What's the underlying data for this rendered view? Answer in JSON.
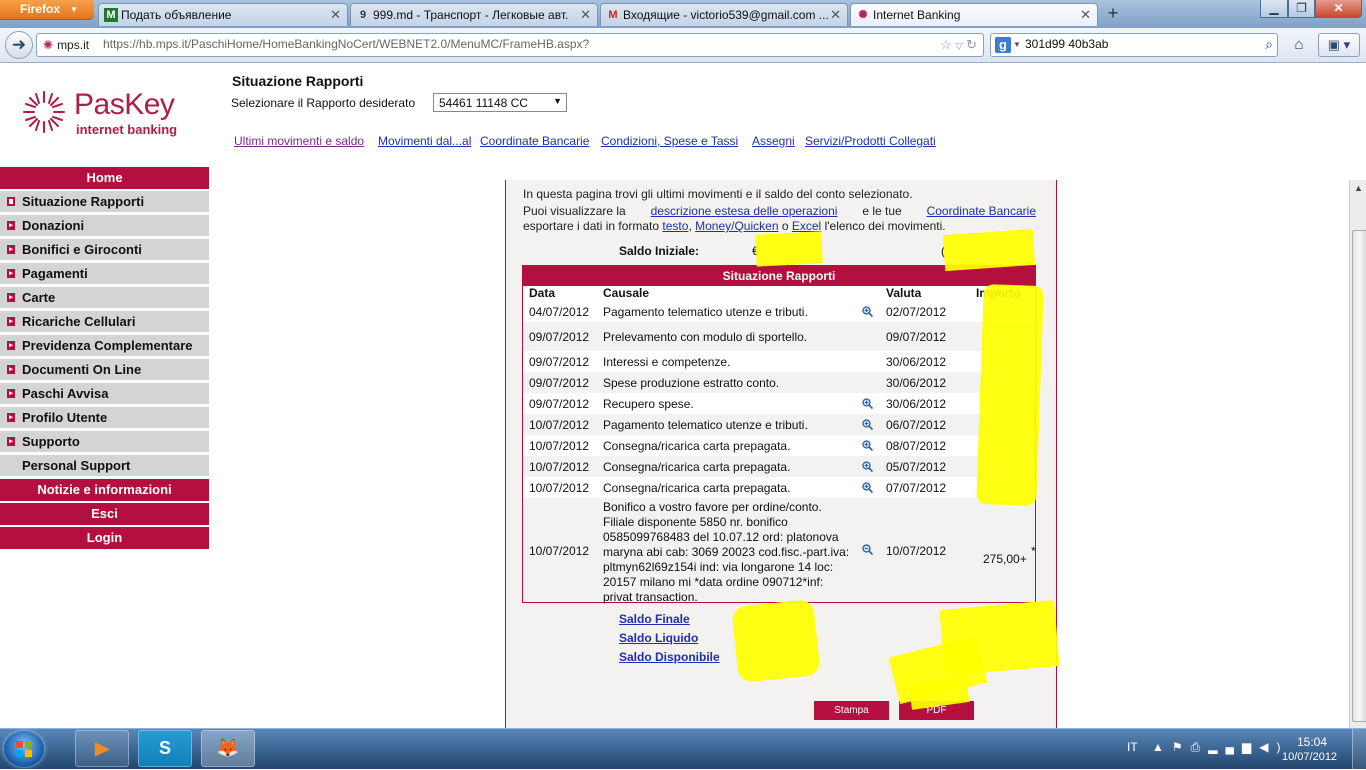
{
  "browser": {
    "menu_button": "Firefox",
    "tabs": [
      {
        "label": "Подать объявление",
        "icon": "M",
        "active": false
      },
      {
        "label": "999.md - Транспорт - Легковые авт...",
        "icon": "9",
        "active": false
      },
      {
        "label": "Входящие - victorio539@gmail.com ...",
        "icon": "M",
        "active": false
      },
      {
        "label": "Internet Banking",
        "icon": "✺",
        "active": true
      }
    ],
    "new_tab": "+",
    "site_identity": "mps.it",
    "url": "https://hb.mps.it/PaschiHome/HomeBankingNoCert/WEBNET2.0/MenuMC/FrameHB.aspx?",
    "search_text": "301d99  40b3ab"
  },
  "logo": {
    "name": "PasKey",
    "sub": "internet banking"
  },
  "header": {
    "title": "Situazione Rapporti",
    "select_label": "Selezionare il Rapporto desiderato",
    "select_value": "54461 11148 CC"
  },
  "top_links": [
    "Ultimi movimenti e saldo",
    "Movimenti dal...al",
    "Coordinate Bancarie",
    "Condizioni, Spese e Tassi",
    "Assegni",
    "Servizi/Prodotti Collegati"
  ],
  "sidebar": [
    {
      "label": "Home",
      "style": "red"
    },
    {
      "label": "Situazione Rapporti",
      "style": "selected"
    },
    {
      "label": "Donazioni",
      "style": "grey"
    },
    {
      "label": "Bonifici e Giroconti",
      "style": "grey"
    },
    {
      "label": "Pagamenti",
      "style": "grey"
    },
    {
      "label": "Carte",
      "style": "grey"
    },
    {
      "label": "Ricariche Cellulari",
      "style": "grey"
    },
    {
      "label": "Previdenza Complementare",
      "style": "grey"
    },
    {
      "label": "Documenti On Line",
      "style": "grey"
    },
    {
      "label": "Paschi Avvisa",
      "style": "grey"
    },
    {
      "label": "Profilo Utente",
      "style": "grey"
    },
    {
      "label": "Supporto",
      "style": "grey"
    },
    {
      "label": "Personal Support",
      "style": "plain"
    },
    {
      "label": "Notizie e informazioni",
      "style": "red"
    },
    {
      "label": "Esci",
      "style": "red"
    },
    {
      "label": "Login",
      "style": "red"
    }
  ],
  "intro": {
    "line1": "In questa pagina trovi gli ultimi movimenti e il saldo del conto selezionato.",
    "line2_a": "Puoi visualizzare la",
    "line2_link1": "descrizione estesa delle operazioni",
    "line2_b": "e le tue",
    "line2_link2": "Coordinate Bancarie",
    "line3_a": "esportare i dati in formato",
    "line3_link1": "testo",
    "line3_sep": ",",
    "line3_link2": "Money/Quicken",
    "line3_b": "o",
    "line3_link3": "Excel",
    "line3_c": "l'elenco dei movimenti."
  },
  "saldo_iniziale": {
    "label": "Saldo Iniziale:",
    "currency": "€",
    "paren": "("
  },
  "table": {
    "title": "Situazione Rapporti",
    "columns": [
      "Data",
      "Causale",
      "Valuta",
      "Importo"
    ],
    "rows": [
      {
        "data": "04/07/2012",
        "causale": "Pagamento telematico utenze e tributi.",
        "valuta": "02/07/2012",
        "detail": true
      },
      {
        "data": "09/07/2012",
        "causale": "Prelevamento con modulo di sportello.",
        "valuta": "09/07/2012",
        "detail": false
      },
      {
        "data": "09/07/2012",
        "causale": "Interessi e competenze.",
        "valuta": "30/06/2012",
        "detail": false
      },
      {
        "data": "09/07/2012",
        "causale": "Spese produzione estratto conto.",
        "valuta": "30/06/2012",
        "detail": false
      },
      {
        "data": "09/07/2012",
        "causale": "Recupero spese.",
        "valuta": "30/06/2012",
        "detail": true
      },
      {
        "data": "10/07/2012",
        "causale": "Pagamento telematico utenze e tributi.",
        "valuta": "06/07/2012",
        "detail": true
      },
      {
        "data": "10/07/2012",
        "causale": "Consegna/ricarica carta prepagata.",
        "valuta": "08/07/2012",
        "detail": true
      },
      {
        "data": "10/07/2012",
        "causale": "Consegna/ricarica carta prepagata.",
        "valuta": "05/07/2012",
        "detail": true
      },
      {
        "data": "10/07/2012",
        "causale": "Consegna/ricarica carta prepagata.",
        "valuta": "07/07/2012",
        "detail": true
      }
    ],
    "last_row": {
      "data": "10/07/2012",
      "causale_lines": [
        "Bonifico a vostro favore per ordine/conto.",
        "Filiale disponente 5850 nr. bonifico",
        "0585099768483 del 10.07.12 ord: platonova",
        "maryna abi cab: 3069 20023 cod.fisc.-part.iva:",
        "pltmyn62l69z154i ind: via longarone 14 loc:",
        "20157 milano mi *data ordine 090712*inf:",
        "privat transaction."
      ],
      "valuta": "10/07/2012",
      "importo": "275,00+",
      "flag": "*"
    }
  },
  "saldi": [
    "Saldo Finale",
    "Saldo Liquido",
    "Saldo Disponibile"
  ],
  "buttons": {
    "print": "Stampa",
    "pdf": "PDF"
  },
  "taskbar": {
    "lang": "IT",
    "time": "15:04",
    "date": "10/07/2012",
    "apps": [
      {
        "name": "media-player",
        "glyph": "▶"
      },
      {
        "name": "skype",
        "glyph": "S"
      },
      {
        "name": "firefox",
        "glyph": "🦊"
      }
    ]
  },
  "colors": {
    "brand": "#b3103f",
    "link": "#1f2fb0"
  }
}
